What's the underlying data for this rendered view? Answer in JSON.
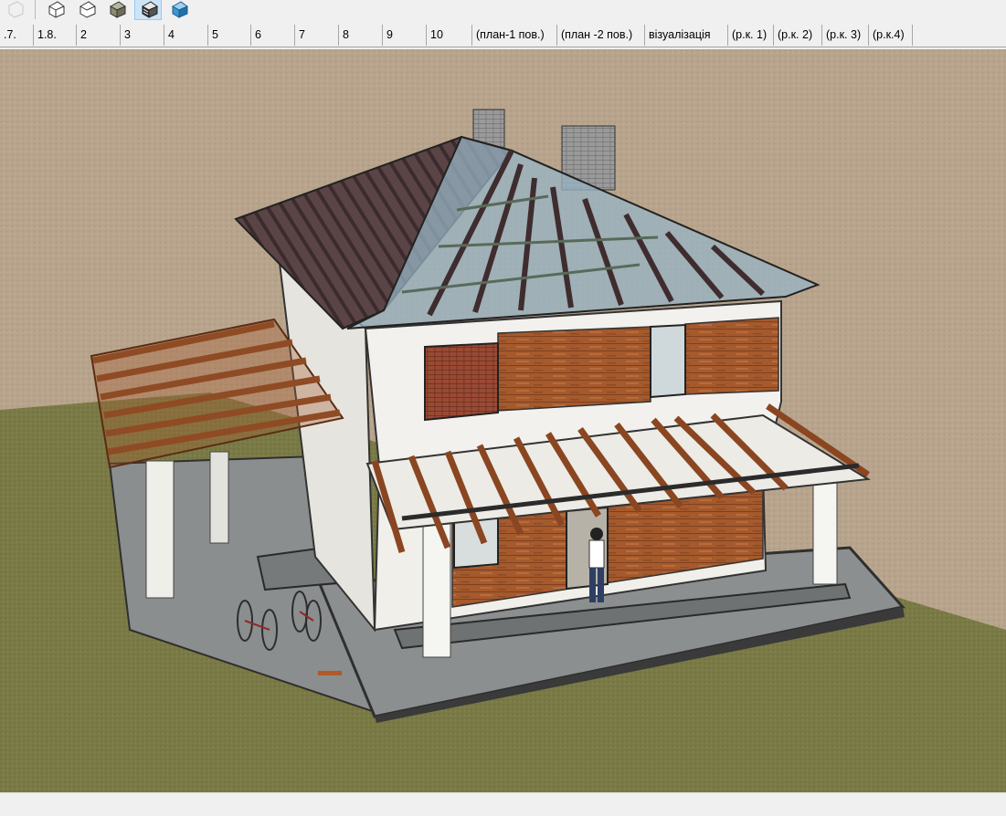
{
  "toolbar": {
    "buttons": [
      {
        "icon": "face-style-wireframe-icon",
        "active": false
      },
      {
        "icon": "face-style-hidden-line-icon",
        "active": false
      },
      {
        "icon": "face-style-shaded-icon",
        "active": false
      },
      {
        "icon": "face-style-shaded-textures-icon",
        "active": false
      },
      {
        "icon": "face-style-monochrome-icon",
        "active": true
      }
    ]
  },
  "scene_tabs": [
    {
      "label": ".7."
    },
    {
      "label": "1.8."
    },
    {
      "label": "2"
    },
    {
      "label": "3"
    },
    {
      "label": "4"
    },
    {
      "label": "5"
    },
    {
      "label": "6"
    },
    {
      "label": "7"
    },
    {
      "label": "8"
    },
    {
      "label": "9"
    },
    {
      "label": "10"
    },
    {
      "label": "(план-1 пов.)"
    },
    {
      "label": "(план -2 пов.)"
    },
    {
      "label": "візуалізація"
    },
    {
      "label": "(р.к. 1)"
    },
    {
      "label": "(р.к. 2)"
    },
    {
      "label": "(р.к. 3)"
    },
    {
      "label": "(р.к.4)"
    }
  ],
  "viewport": {
    "model": "two-storey-house-with-hip-roof-and-pergolas",
    "colors": {
      "sky": "#b7a48d",
      "ground": "#7a7a46",
      "wall": "#f1f0ec",
      "wood": "#a3582c",
      "roof": "#4e3a3c",
      "slab": "#8c8f8f"
    }
  }
}
